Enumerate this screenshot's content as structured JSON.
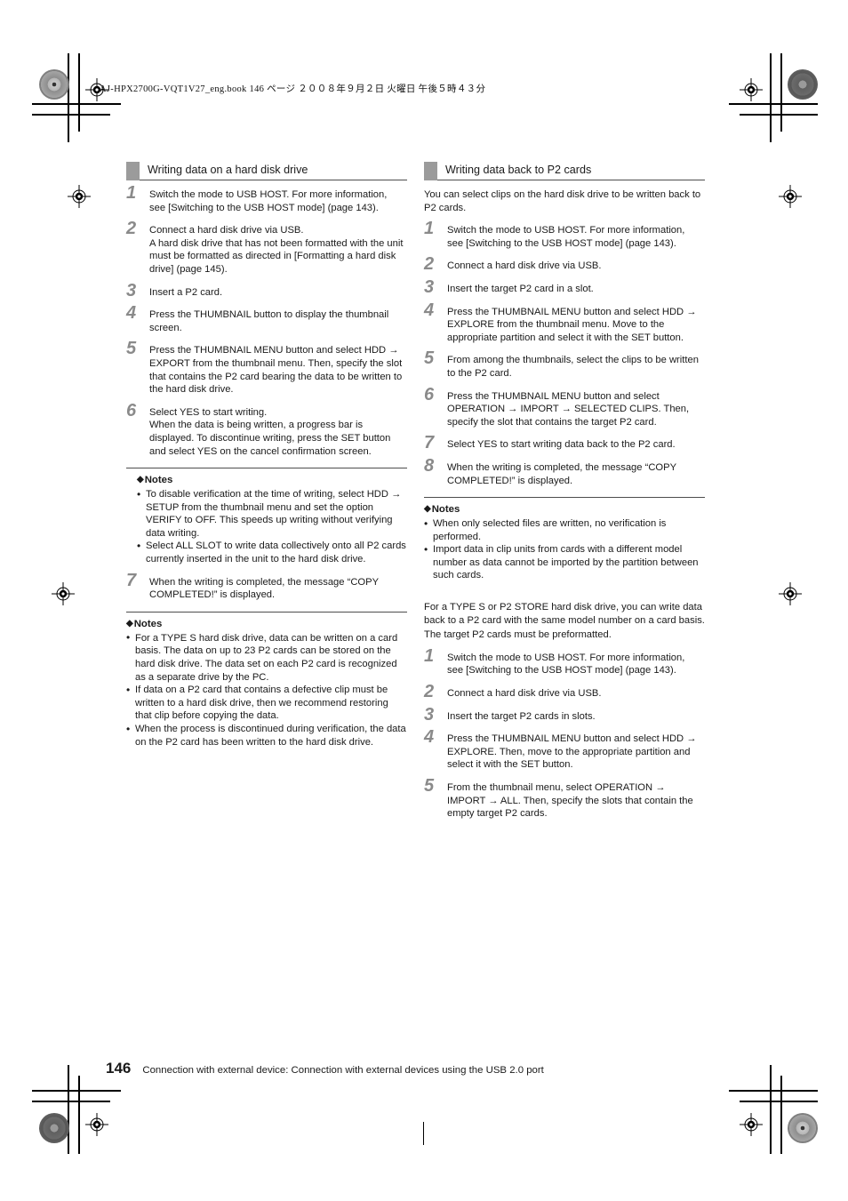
{
  "header": {
    "file_slug": "AJ-HPX2700G-VQT1V27_eng.book   146 ページ   ２００８年９月２日   火曜日   午後５時４３分"
  },
  "footer": {
    "page_number": "146",
    "text": "Connection with external device: Connection with external devices using the USB 2.0 port"
  },
  "colors": {
    "section_chip": "#9b9b9b",
    "step_number": "#8a8a8a",
    "rule": "#4d4d4d",
    "body_text": "#1a1a1a"
  },
  "icons": {
    "notes_diamond": "◆",
    "bullet": "•",
    "arrow": "→"
  },
  "left_column": {
    "section_title": "Writing data on a hard disk drive",
    "steps_main": [
      {
        "num": "1",
        "line1": "Switch the mode to USB HOST. For more information,",
        "line2": "see [Switching to the USB HOST mode] (page 143)."
      },
      {
        "num": "2",
        "line1": "Connect a hard disk drive via USB.",
        "line2": "A hard disk drive that has not been formatted with the unit must be formatted as directed in [Formatting a hard disk drive] (page 145)."
      },
      {
        "num": "3",
        "line1": "Insert a P2 card.",
        "line2": ""
      },
      {
        "num": "4",
        "line1": "Press the THUMBNAIL button to display the thumbnail screen.",
        "line2": ""
      },
      {
        "num": "5",
        "line1": "Press the THUMBNAIL MENU button and select HDD → EXPORT from the thumbnail menu. Then, specify the slot that contains the P2 card bearing the data to be written to the hard disk drive.",
        "line2": ""
      },
      {
        "num": "6",
        "line1": "Select YES to start writing.",
        "line2": "When the data is being written, a progress bar is displayed. To discontinue writing, press the SET button and select YES on the cancel confirmation screen."
      }
    ],
    "notes_inline": {
      "heading": "Notes",
      "items": [
        "To disable verification at the time of writing, select HDD → SETUP from the thumbnail menu and set the option VERIFY to OFF. This speeds up writing without verifying data writing.",
        "Select ALL SLOT to write data collectively onto all P2 cards currently inserted in the unit to the hard disk drive."
      ]
    },
    "step_seven": {
      "num": "7",
      "line1": "When the writing is completed, the message “COPY COMPLETED!” is displayed.",
      "line2": ""
    },
    "notes_final": {
      "heading": "Notes",
      "items": [
        "For a TYPE S hard disk drive, data can be written on a card basis. The data on up to 23 P2 cards can be stored on the hard disk drive. The data set on each P2 card is recognized as a separate drive by the PC.",
        "If data on a P2 card that contains a defective clip must be written to a hard disk drive, then we recommend restoring that clip before copying the data.",
        "When the process is discontinued during verification, the data on the P2 card has been written to the hard disk drive."
      ]
    }
  },
  "right_column": {
    "section_title": "Writing data back to P2 cards",
    "intro": "You can select clips on the hard disk drive to be written back to P2 cards.",
    "steps_main": [
      {
        "num": "1",
        "line1": "Switch the mode to USB HOST. For more information,",
        "line2": "see [Switching to the USB HOST mode] (page 143)."
      },
      {
        "num": "2",
        "line1": "Connect a hard disk drive via USB.",
        "line2": ""
      },
      {
        "num": "3",
        "line1": "Insert the target P2 card in a slot.",
        "line2": ""
      },
      {
        "num": "4",
        "line1": "Press the THUMBNAIL MENU button and select HDD → EXPLORE from the thumbnail menu. Move to the appropriate partition and select it with the SET button.",
        "line2": ""
      },
      {
        "num": "5",
        "line1": "From among the thumbnails, select the clips to be written to the P2 card.",
        "line2": ""
      },
      {
        "num": "6",
        "line1": "Press the THUMBNAIL MENU button and select OPERATION → IMPORT → SELECTED CLIPS. Then, specify the slot that contains the target P2 card.",
        "line2": ""
      },
      {
        "num": "7",
        "line1": "Select YES to start writing data back to the P2 card.",
        "line2": ""
      },
      {
        "num": "8",
        "line1": "When the writing is completed, the message “COPY COMPLETED!” is displayed.",
        "line2": ""
      }
    ],
    "notes": {
      "heading": "Notes",
      "items": [
        "When only selected files are written, no verification is performed.",
        "Import data in clip units from cards with a different model number as data cannot be imported by the partition between such cards."
      ]
    },
    "type_s_para_1": "For a TYPE S or P2 STORE hard disk drive, you can write data back to a P2 card with the same model number on a card basis.",
    "type_s_para_2": "The target P2 cards must be preformatted.",
    "steps_tail": [
      {
        "num": "1",
        "line1": "Switch the mode to USB HOST. For more information,",
        "line2": "see [Switching to the USB HOST mode] (page 143)."
      },
      {
        "num": "2",
        "line1": "Connect a hard disk drive via USB.",
        "line2": ""
      },
      {
        "num": "3",
        "line1": "Insert the target P2 cards in slots.",
        "line2": ""
      },
      {
        "num": "4",
        "line1": "Press the THUMBNAIL MENU button and select HDD → EXPLORE. Then, move to the appropriate partition and select it with the SET button.",
        "line2": ""
      },
      {
        "num": "5",
        "line1": "From the thumbnail menu, select OPERATION → IMPORT → ALL. Then, specify the slots that contain the empty target P2 cards.",
        "line2": ""
      }
    ]
  }
}
